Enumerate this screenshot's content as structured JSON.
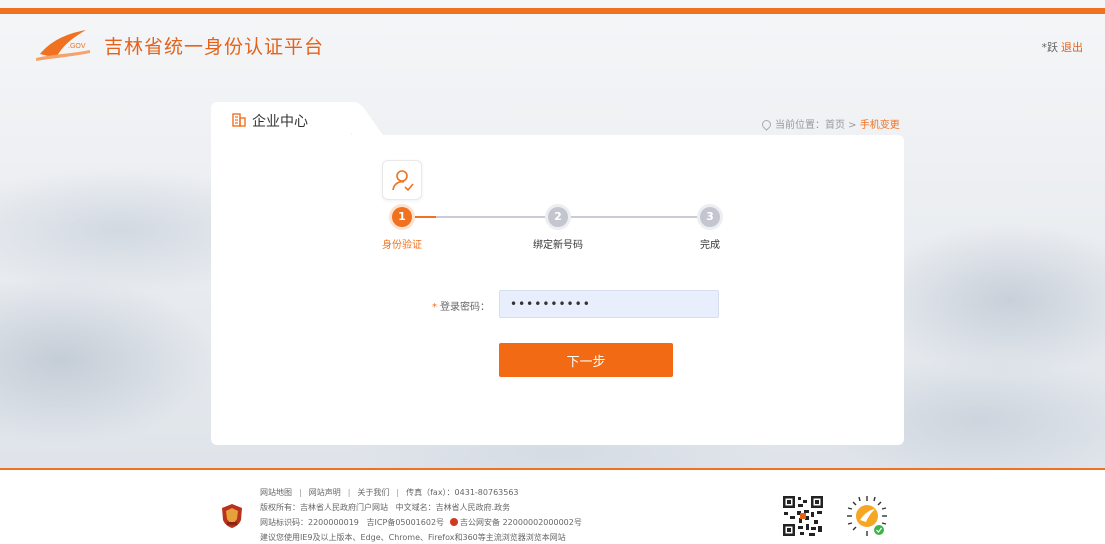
{
  "header": {
    "site_title": "吉林省统一身份认证平台",
    "user_label": "*跃",
    "logout_label": "退出"
  },
  "card": {
    "tab_title": "企业中心",
    "breadcrumb": {
      "prefix": "当前位置：",
      "home": "首页",
      "separator": " > ",
      "current": "手机变更"
    }
  },
  "steps": [
    {
      "number": "1",
      "label": "身份验证",
      "active": true
    },
    {
      "number": "2",
      "label": "绑定新号码",
      "active": false
    },
    {
      "number": "3",
      "label": "完成",
      "active": false
    }
  ],
  "form": {
    "required_mark": "*",
    "password_label": "登录密码：",
    "password_value": "••••••••••",
    "next_button": "下一步"
  },
  "footer": {
    "line1": {
      "links": [
        "网站地图",
        "网站声明",
        "关于我们"
      ],
      "fax": "传真（fax）：0431-80763563"
    },
    "line2": {
      "copyright": "版权所有：吉林省人民政府门户网站",
      "domain": "中文域名：吉林省人民政府.政务"
    },
    "line3": {
      "site_code": "网站标识码：2200000019",
      "icp": "吉ICP备05001602号",
      "police": "吉公网安备 22000002000002号"
    },
    "line4": "建议您使用IE9及以上版本、Edge、Chrome、Firefox和360等主流浏览器浏览本网站"
  },
  "colors": {
    "accent": "#f0711f",
    "button": "#f26a14",
    "input_bg": "#e8eefb"
  },
  "icons": {
    "logo": "jilin-gov-logo",
    "tab": "building-icon",
    "breadcrumb": "location-pin-icon",
    "step_avatar": "user-check-icon"
  }
}
